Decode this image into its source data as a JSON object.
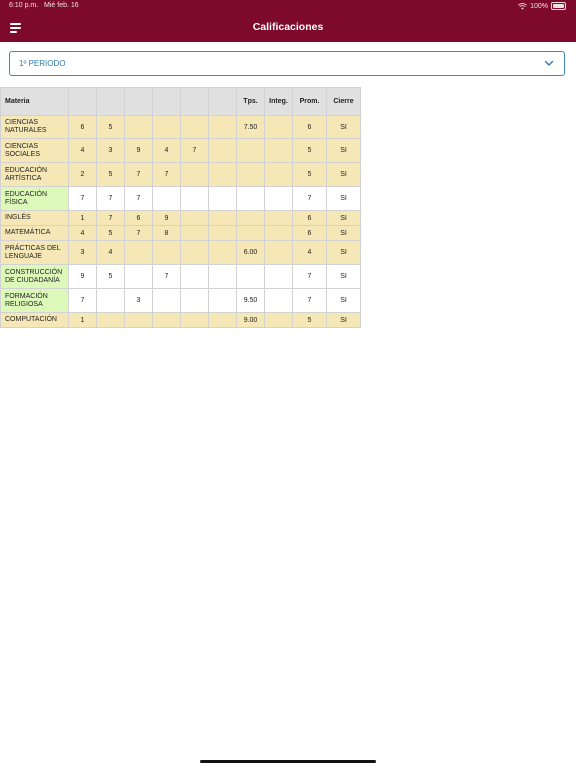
{
  "status": {
    "time": "6:10 p.m.",
    "date": "Mié feb. 16",
    "battery": "100%"
  },
  "header": {
    "title": "Calificaciones"
  },
  "period_select": {
    "value": "1º PERIODO"
  },
  "table": {
    "headers": [
      "Materia",
      "",
      "",
      "",
      "",
      "",
      "",
      "Tps.",
      "Integ.",
      "Prom.",
      "Cierre"
    ],
    "rows": [
      {
        "materia": "CIENCIAS NATURALES",
        "style": "yellow",
        "cells": [
          "6",
          "5",
          "",
          "",
          "",
          "",
          "7.50",
          "",
          "6",
          "SI"
        ]
      },
      {
        "materia": "CIENCIAS SOCIALES",
        "style": "yellow",
        "cells": [
          "4",
          "3",
          "9",
          "4",
          "7",
          "",
          "",
          "",
          "5",
          "SI"
        ]
      },
      {
        "materia": "EDUCACIÓN ARTÍSTICA",
        "style": "yellow",
        "cells": [
          "2",
          "5",
          "7",
          "7",
          "",
          "",
          "",
          "",
          "5",
          "SI"
        ]
      },
      {
        "materia": "EDUCACIÓN FÍSICA",
        "style": "white",
        "cells": [
          "7",
          "7",
          "7",
          "",
          "",
          "",
          "",
          "",
          "7",
          "SI"
        ]
      },
      {
        "materia": "INGLÉS",
        "style": "yellow",
        "cells": [
          "1",
          "7",
          "6",
          "9",
          "",
          "",
          "",
          "",
          "6",
          "SI"
        ]
      },
      {
        "materia": "MATEMÁTICA",
        "style": "yellow",
        "cells": [
          "4",
          "5",
          "7",
          "8",
          "",
          "",
          "",
          "",
          "6",
          "SI"
        ]
      },
      {
        "materia": "PRÁCTICAS DEL LENGUAJE",
        "style": "yellow",
        "cells": [
          "3",
          "4",
          "",
          "",
          "",
          "",
          "6.00",
          "",
          "4",
          "SI"
        ]
      },
      {
        "materia": "CONSTRUCCIÓN DE CIUDADANÍA",
        "style": "white",
        "cells": [
          "9",
          "5",
          "",
          "7",
          "",
          "",
          "",
          "",
          "7",
          "SI"
        ]
      },
      {
        "materia": "FORMACIÓN RELIGIOSA",
        "style": "white",
        "cells": [
          "7",
          "",
          "3",
          "",
          "",
          "",
          "9.50",
          "",
          "7",
          "SI"
        ]
      },
      {
        "materia": "COMPUTACIÓN",
        "style": "yellow",
        "cells": [
          "1",
          "",
          "",
          "",
          "",
          "",
          "9.00",
          "",
          "5",
          "SI"
        ]
      }
    ]
  },
  "colors": {
    "appbar": "#7d0a2b",
    "accent": "#2e7bb2",
    "row_yellow": "#f5e8b6",
    "row_green": "#ddf9b9",
    "header_gray": "#e0e0e0"
  }
}
